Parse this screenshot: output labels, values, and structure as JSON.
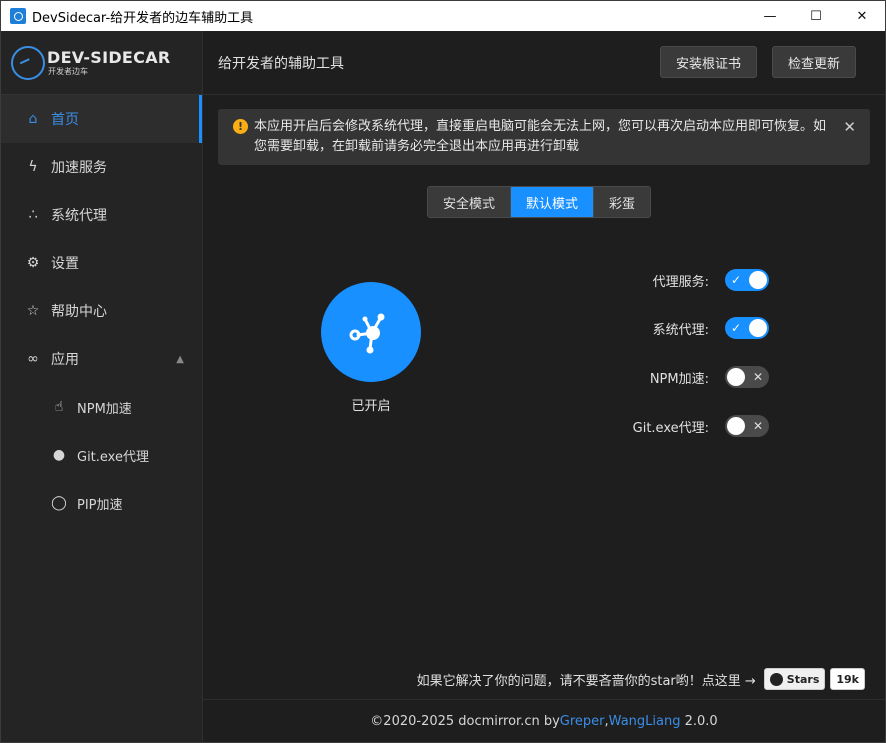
{
  "window": {
    "title": "DevSidecar-给开发者的边车辅助工具"
  },
  "logo": {
    "title": "DEV-SIDECAR",
    "subtitle": "开发者边车"
  },
  "sidebar": {
    "items": [
      {
        "label": "首页",
        "icon": "home-icon"
      },
      {
        "label": "加速服务",
        "icon": "lightning-icon"
      },
      {
        "label": "系统代理",
        "icon": "network-icon"
      },
      {
        "label": "设置",
        "icon": "gear-icon"
      },
      {
        "label": "帮助中心",
        "icon": "star-icon"
      },
      {
        "label": "应用",
        "icon": "link-icon"
      },
      {
        "label": "NPM加速",
        "icon": "thumb-up-icon"
      },
      {
        "label": "Git.exe代理",
        "icon": "github-icon"
      },
      {
        "label": "PIP加速",
        "icon": "bulb-icon"
      }
    ]
  },
  "header": {
    "title": "给开发者的辅助工具",
    "install_cert": "安装根证书",
    "check_update": "检查更新"
  },
  "alert": {
    "text": "本应用开启后会修改系统代理，直接重启电脑可能会无法上网，您可以再次启动本应用即可恢复。如您需要卸载，在卸载前请务必完全退出本应用再进行卸载"
  },
  "modes": [
    {
      "label": "安全模式",
      "active": false
    },
    {
      "label": "默认模式",
      "active": true
    },
    {
      "label": "彩蛋",
      "active": false
    }
  ],
  "power": {
    "status": "已开启"
  },
  "switches": [
    {
      "label": "代理服务:",
      "on": true
    },
    {
      "label": "系统代理:",
      "on": true
    },
    {
      "label": "NPM加速:",
      "on": false
    },
    {
      "label": "Git.exe代理:",
      "on": false
    }
  ],
  "star": {
    "text": "如果它解决了你的问题，请不要吝啬你的star哟！点这里 →",
    "button": "Stars",
    "count": "19k"
  },
  "footer": {
    "prefix": "©2020-2025 docmirror.cn by ",
    "author1": "Greper",
    "sep": ", ",
    "author2": "WangLiang",
    "version": " 2.0.0"
  },
  "colors": {
    "accent": "#1890ff",
    "warning": "#faad14"
  }
}
